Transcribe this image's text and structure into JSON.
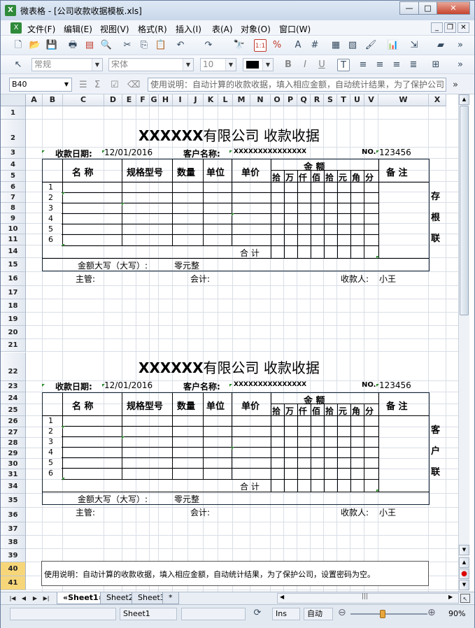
{
  "window": {
    "app_name": "微表格",
    "title": "微表格 - [公司收款收据模板.xls]"
  },
  "menu": [
    "文件(F)",
    "编辑(E)",
    "视图(V)",
    "格式(R)",
    "插入(I)",
    "表(A)",
    "对象(O)",
    "窗口(W)"
  ],
  "format_toolbar": {
    "number_format": "常规",
    "font_name": "宋体",
    "font_size": "10"
  },
  "formula_bar": {
    "cell_ref": "B40",
    "content": "使用说明：自动计算的收款收据，填入相应金额，自动统计结果，为了保护公司"
  },
  "columns": [
    "A",
    "B",
    "C",
    "D",
    "E",
    "F",
    "G",
    "H",
    "I",
    "J",
    "K",
    "L",
    "M",
    "N",
    "O",
    "P",
    "Q",
    "R",
    "S",
    "T",
    "U",
    "V",
    "W",
    "X"
  ],
  "rows_top": [
    "1",
    "2",
    "3",
    "4",
    "5",
    "6",
    "7",
    "8",
    "9",
    "10",
    "11",
    "14",
    "15",
    "16",
    "17",
    "18",
    "19",
    "20",
    "21"
  ],
  "rows_bottom": [
    "22",
    "23",
    "24",
    "25",
    "26",
    "27",
    "28",
    "29",
    "30",
    "31",
    "34",
    "35",
    "36",
    "37",
    "38",
    "39",
    "40",
    "41"
  ],
  "receipt": {
    "company_title_prefix": "XXXXXX",
    "company_title_suffix": "有限公司  收款收据",
    "date_label": "收款日期:",
    "date_value": "12/01/2016",
    "customer_label": "客户名称:",
    "customer_value": "XXXXXXXXXXXXXXX",
    "no_label": "NO.",
    "no_value": "123456",
    "headers": {
      "name": "名 称",
      "spec": "规格型号",
      "qty": "数量",
      "unit": "单位",
      "price": "单价",
      "amount": "金    额",
      "remark": "备  注"
    },
    "digit_headers": [
      "拾",
      "万",
      "仟",
      "佰",
      "拾",
      "元",
      "角",
      "分"
    ],
    "item_numbers": [
      "1",
      "2",
      "3",
      "4",
      "5",
      "6"
    ],
    "total_label": "合 计",
    "amount_words_label": "金额大写（大写）:",
    "amount_words_value": "零元整",
    "supervisor_label": "主管:",
    "accountant_label": "会计:",
    "payee_label": "收款人:",
    "payee_value": "小王",
    "copy1_side": [
      "存",
      "根",
      "联"
    ],
    "copy2_side": [
      "客",
      "户",
      "联"
    ]
  },
  "note_text": "使用说明：自动计算的收款收据，填入相应金额，自动统计结果，为了保护公司，设置密码为空。",
  "sheet_tabs": [
    "«Sheet1»",
    "Sheet2",
    "Sheet3",
    "*"
  ],
  "status": {
    "sheet": "Sheet1",
    "ins": "Ins",
    "mode": "自动",
    "zoom": "90%"
  }
}
